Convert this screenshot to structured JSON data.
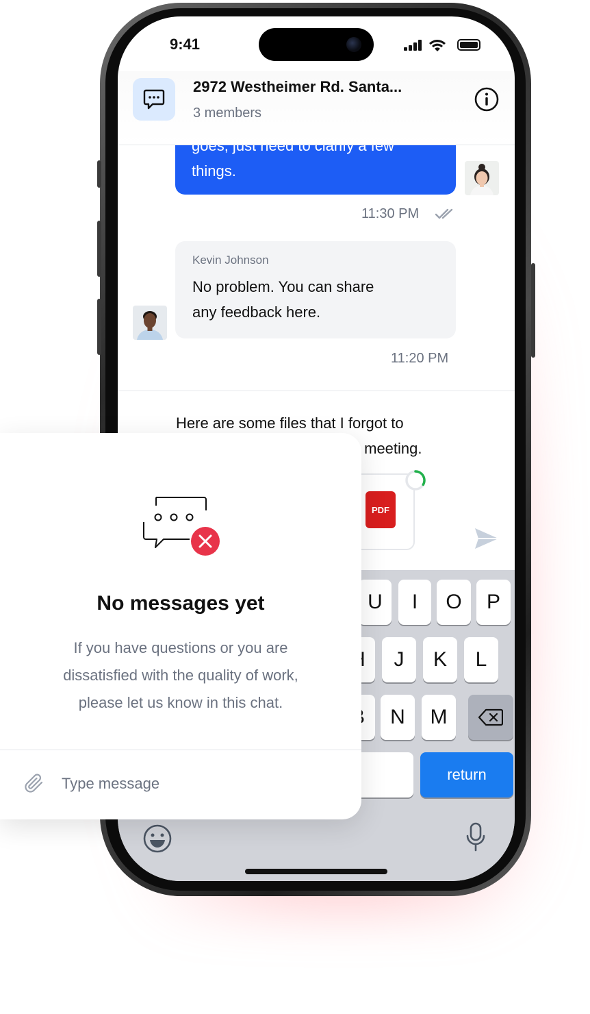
{
  "status_bar": {
    "time": "9:41"
  },
  "header": {
    "title": "2972 Westheimer Rd. Santa...",
    "members": "3 members"
  },
  "messages": [
    {
      "direction": "outgoing",
      "text_lines": [
        "goes, just need to clarify a few",
        "things."
      ],
      "time": "11:30 PM",
      "status": "read"
    },
    {
      "direction": "incoming",
      "sender": "Kevin Johnson",
      "text_lines": [
        "No problem. You can share",
        "any feedback here."
      ],
      "time": "11:20 PM"
    }
  ],
  "compose": {
    "text": "Here are some files that I forgot to ... meeting.",
    "text_lines": [
      "Here are some files that I forgot to",
      "s meeting."
    ],
    "attachment": {
      "type": "PDF",
      "label": "PDF"
    }
  },
  "keyboard": {
    "row1": [
      "U",
      "I",
      "O",
      "P"
    ],
    "row2": [
      "H",
      "J",
      "K",
      "L"
    ],
    "row3": [
      "B",
      "N",
      "M"
    ],
    "return_label": "return"
  },
  "empty_state": {
    "title": "No messages yet",
    "description": "If you have questions or you are dissatisfied with the quality of work, please let us know in this chat.",
    "description_lines": [
      "If you have questions or you are",
      "dissatisfied with the quality of work,",
      "please let us know in this chat."
    ]
  },
  "input": {
    "placeholder": "Type message"
  },
  "colors": {
    "accent": "#1d5df5",
    "incoming_bubble": "#f3f4f6",
    "error": "#e8344a",
    "return_key": "#1a7cf0",
    "pdf": "#d81e1e",
    "progress": "#22b14c"
  }
}
